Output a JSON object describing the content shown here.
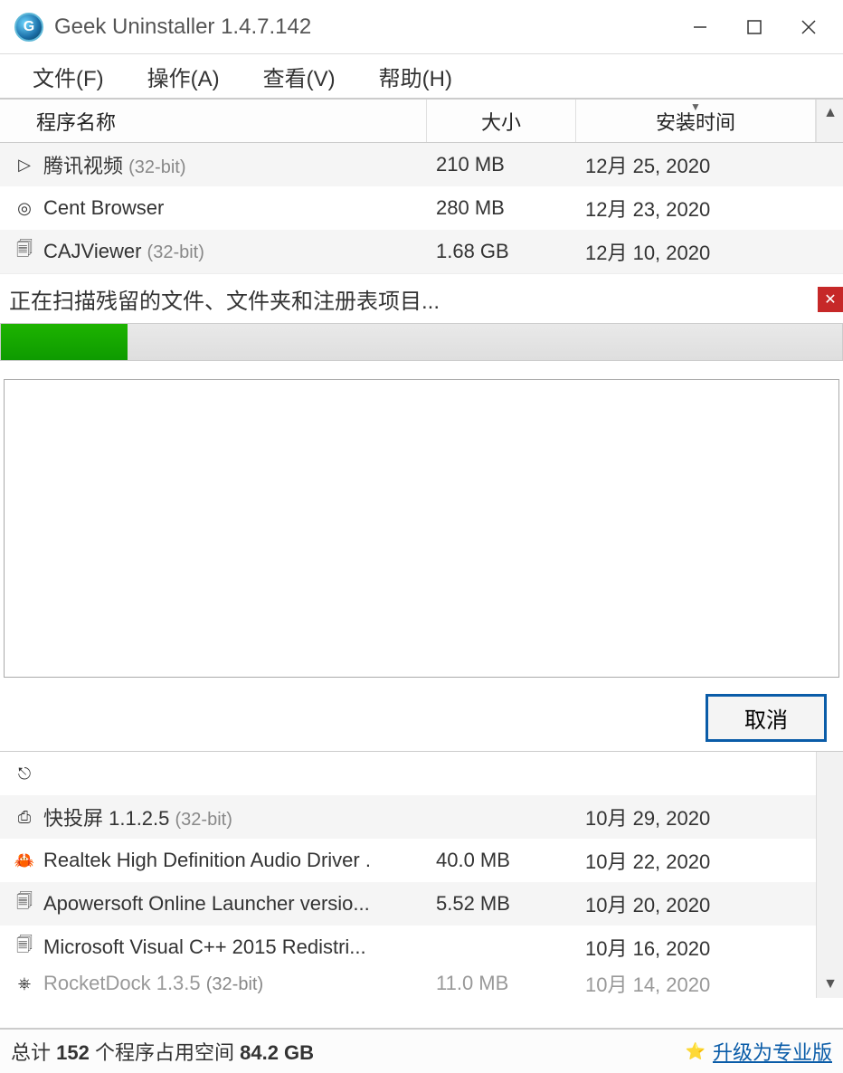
{
  "titlebar": {
    "title": "Geek Uninstaller 1.4.7.142",
    "app_icon_letter": "G"
  },
  "menu": {
    "file": "文件(F)",
    "action": "操作(A)",
    "view": "查看(V)",
    "help": "帮助(H)"
  },
  "columns": {
    "name": "程序名称",
    "size": "大小",
    "date": "安装时间"
  },
  "rows_top": [
    {
      "icon": "play-icon",
      "glyph": "▷",
      "name": "腾讯视频",
      "bits": "(32-bit)",
      "size": "210 MB",
      "date": "12月 25, 2020",
      "alt": true
    },
    {
      "icon": "cent-icon",
      "glyph": "◎",
      "name": "Cent Browser",
      "bits": "",
      "size": "280 MB",
      "date": "12月 23, 2020",
      "alt": false
    },
    {
      "icon": "caj-icon",
      "glyph": "🗐",
      "name": "CAJViewer",
      "bits": "(32-bit)",
      "size": "1.68 GB",
      "date": "12月 10, 2020",
      "alt": true
    }
  ],
  "dialog": {
    "status": "正在扫描残留的文件、文件夹和注册表项目...",
    "progress_percent": 15,
    "cancel": "取消"
  },
  "rows_bottom": [
    {
      "icon": "generic-icon",
      "glyph": "⎋",
      "name": "",
      "bits": "",
      "size": "",
      "date": "",
      "alt": false
    },
    {
      "icon": "cast-icon",
      "glyph": "⎙",
      "name": "快投屏 1.1.2.5",
      "bits": "(32-bit)",
      "size": "",
      "date": "10月 29, 2020",
      "alt": true
    },
    {
      "icon": "realtek-icon",
      "glyph": "🦀",
      "name": "Realtek High Definition Audio Driver .",
      "bits": "",
      "size": "40.0 MB",
      "date": "10月 22, 2020",
      "alt": false
    },
    {
      "icon": "apower-icon",
      "glyph": "🗐",
      "name": "Apowersoft Online Launcher versio...",
      "bits": "",
      "size": "5.52 MB",
      "date": "10月 20, 2020",
      "alt": true
    },
    {
      "icon": "msvc-icon",
      "glyph": "🗐",
      "name": "Microsoft Visual C++ 2015 Redistri...",
      "bits": "",
      "size": "",
      "date": "10月 16, 2020",
      "alt": false
    }
  ],
  "row_partial": {
    "icon": "rocket-icon",
    "glyph": "⎈",
    "name": "RocketDock 1.3.5",
    "bits": "(32-bit)",
    "size": "11.0 MB",
    "date": "10月 14, 2020"
  },
  "statusbar": {
    "prefix": "总计",
    "count": "152",
    "mid": "个程序占用空间",
    "space": "84.2 GB",
    "upgrade": "升级为专业版"
  }
}
